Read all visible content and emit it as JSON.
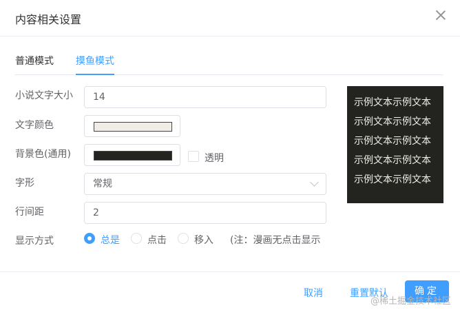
{
  "dialog": {
    "title": "内容相关设置"
  },
  "tabs": [
    {
      "label": "普通模式",
      "active": false
    },
    {
      "label": "摸鱼模式",
      "active": true
    }
  ],
  "form": {
    "font_size": {
      "label": "小说文字大小",
      "value": "14"
    },
    "text_color": {
      "label": "文字颜色",
      "color": "#efede6"
    },
    "bg_color": {
      "label": "背景色(通用)",
      "color": "#23241f",
      "transparent_label": "透明",
      "transparent_checked": false
    },
    "font_style": {
      "label": "字形",
      "value": "常规"
    },
    "line_height": {
      "label": "行间距",
      "value": "2"
    },
    "display_mode": {
      "label": "显示方式",
      "options": [
        {
          "label": "总是",
          "selected": true
        },
        {
          "label": "点击",
          "selected": false
        },
        {
          "label": "移入",
          "selected": false
        }
      ],
      "note": "(注：漫画无点击显示"
    }
  },
  "preview": {
    "lines": [
      "示例文本示例文本",
      "示例文本示例文本",
      "示例文本示例文本",
      "示例文本示例文本",
      "示例文本示例文本"
    ],
    "bg": "#23241f",
    "fg": "#efede6"
  },
  "footer": {
    "cancel_label": "取消",
    "reset_label": "重置默认",
    "confirm_label": "确定"
  },
  "watermark": "@稀土掘金技术社区",
  "colors": {
    "accent": "#409eff"
  }
}
